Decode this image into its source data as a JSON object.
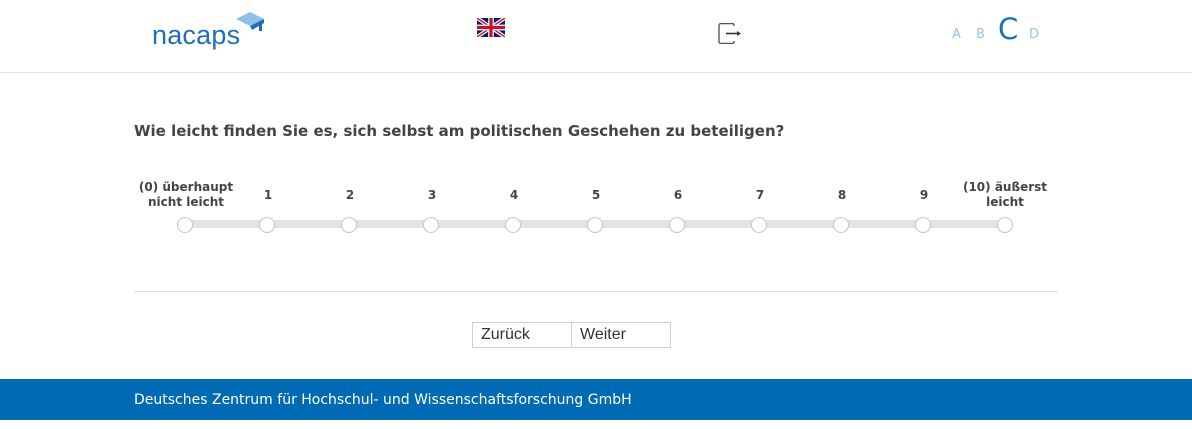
{
  "header": {
    "logo_text": "nacaps",
    "language_flag": "uk-flag-icon",
    "logout_icon": "logout-icon",
    "levels": [
      {
        "label": "A",
        "active": false
      },
      {
        "label": "B",
        "active": false
      },
      {
        "label": "C",
        "active": true
      },
      {
        "label": "D",
        "active": false
      }
    ]
  },
  "question": {
    "text": "Wie leicht finden Sie es, sich selbst am politischen Geschehen zu beteiligen?"
  },
  "scale": {
    "options": [
      {
        "label": "(0) überhaupt nicht leicht",
        "line1": "(0) überhaupt",
        "line2": "nicht leicht"
      },
      {
        "label": "1"
      },
      {
        "label": "2"
      },
      {
        "label": "3"
      },
      {
        "label": "4"
      },
      {
        "label": "5"
      },
      {
        "label": "6"
      },
      {
        "label": "7"
      },
      {
        "label": "8"
      },
      {
        "label": "9"
      },
      {
        "label": "(10) äußerst leicht",
        "line1": "(10) äußerst",
        "line2": "leicht"
      }
    ],
    "selected": null
  },
  "nav": {
    "back_label": "Zurück",
    "next_label": "Weiter"
  },
  "footer": {
    "text": "Deutsches Zentrum für Hochschul- und Wissenschaftsforschung GmbH"
  },
  "colors": {
    "brand": "#1d6fb8",
    "footer_bg": "#006ab5",
    "level_inactive": "#9cc3e3"
  }
}
